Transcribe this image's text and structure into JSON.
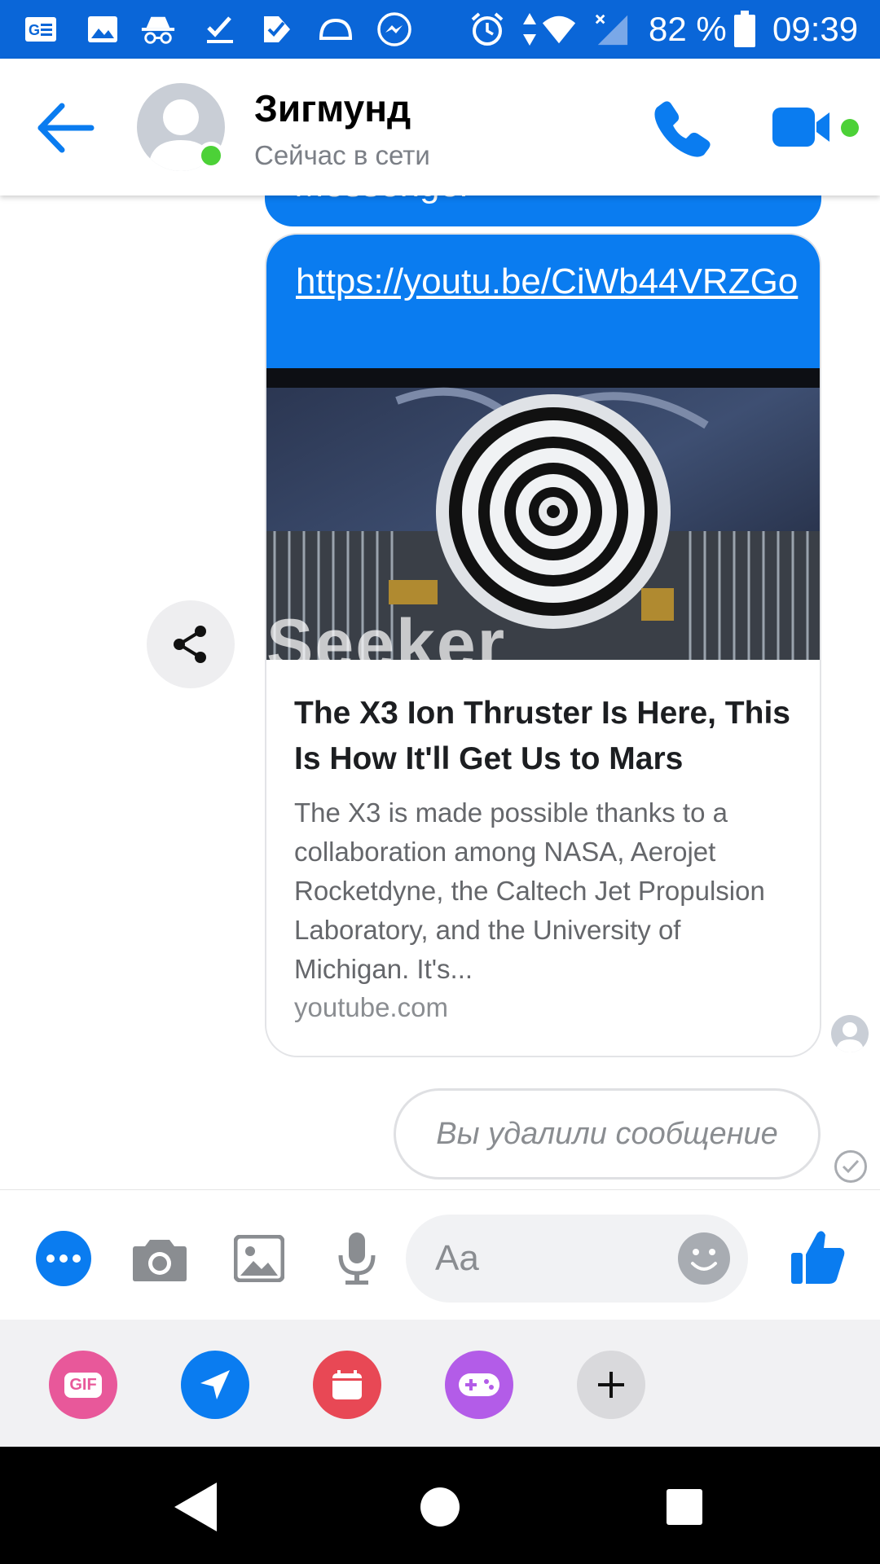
{
  "status_bar": {
    "battery": "82 %",
    "time": "09:39"
  },
  "header": {
    "contact_name": "Зигмунд",
    "contact_status": "Сейчас в сети"
  },
  "messages": {
    "previous_fragment": "Messenger",
    "link": {
      "url": "https://youtu.be/CiWb44VRZGo",
      "preview_brand": "Seeker",
      "title": "The X3 Ion Thruster Is Here, This Is How It'll Get Us to Mars",
      "description": "The X3 is made possible thanks to a collaboration among NASA, Aerojet Rocketdyne, the Caltech Jet Propulsion Laboratory, and the University of Michigan. It's...",
      "domain": "youtube.com"
    },
    "deleted_text": "Вы удалили сообщение"
  },
  "composer": {
    "placeholder": "Aa"
  },
  "colors": {
    "accent": "#0a7cf0",
    "status_bar": "#0a66d8",
    "online": "#4cd137",
    "gif": "#e8589a",
    "location": "#0a7cf0",
    "calendar": "#e84855",
    "games": "#b35ce8"
  },
  "icons": {
    "back": "arrow-left-icon",
    "call": "phone-icon",
    "video": "video-camera-icon",
    "share": "share-icon",
    "more": "more-dots-icon",
    "camera": "camera-icon",
    "gallery": "image-icon",
    "mic": "microphone-icon",
    "emoji": "emoji-icon",
    "like": "thumbs-up-icon",
    "gif": "gif-icon",
    "location": "location-arrow-icon",
    "calendar": "calendar-icon",
    "games": "gamepad-icon",
    "add": "plus-icon",
    "nav_back": "triangle-back-icon",
    "nav_home": "circle-home-icon",
    "nav_recent": "square-recents-icon"
  }
}
